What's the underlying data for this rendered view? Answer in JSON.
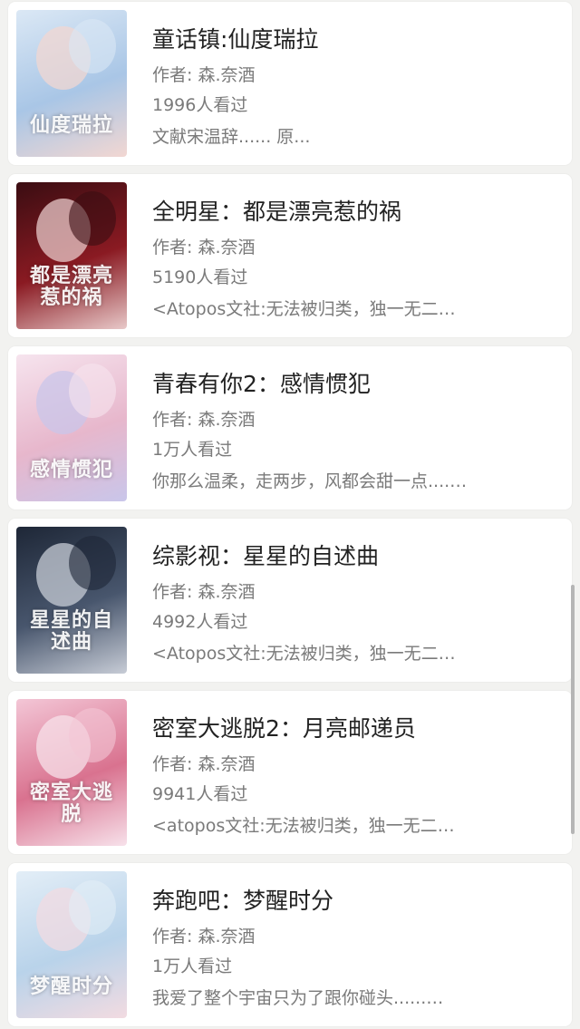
{
  "author_prefix": "作者:",
  "books": [
    {
      "title": "童话镇:仙度瑞拉",
      "author": "森.奈酒",
      "views": "1996人看过",
      "desc": "文献宋温辞...... 原...",
      "cover_text": "仙度瑞拉",
      "cover_colors": [
        "#dbe8f5",
        "#a9c6e6",
        "#f2d7d2"
      ]
    },
    {
      "title": "全明星：都是漂亮惹的祸",
      "author": "森.奈酒",
      "views": "5190人看过",
      "desc": "<Atopos文社:无法被归类，独一无二…",
      "cover_text": "都是漂亮惹的祸",
      "cover_colors": [
        "#3a0d12",
        "#8a1a22",
        "#e8c9c9"
      ]
    },
    {
      "title": "青春有你2：感情惯犯",
      "author": "森.奈酒",
      "views": "1万人看过",
      "desc": "你那么温柔，走两步，风都会甜一点....…",
      "cover_text": "感情惯犯",
      "cover_colors": [
        "#f6e4ee",
        "#e7b7cc",
        "#c9c6ea"
      ]
    },
    {
      "title": "综影视：星星的自述曲",
      "author": "森.奈酒",
      "views": "4992人看过",
      "desc": "<Atopos文社:无法被归类，独一无二…",
      "cover_text": "星星的自述曲",
      "cover_colors": [
        "#1e2737",
        "#48566d",
        "#c7ccd6"
      ]
    },
    {
      "title": "密室大逃脱2：月亮邮递员",
      "author": "森.奈酒",
      "views": "9941人看过",
      "desc": "<atopos文社:无法被归类，独一无二…",
      "cover_text": "密室大逃脱",
      "cover_colors": [
        "#f3c6d6",
        "#d9728f",
        "#f7e1ea"
      ]
    },
    {
      "title": "奔跑吧：梦醒时分",
      "author": "森.奈酒",
      "views": "1万人看过",
      "desc": "我爱了整个宇宙只为了跟你碰头......…",
      "cover_text": "梦醒时分",
      "cover_colors": [
        "#e3eef7",
        "#b9d3ea",
        "#f2dbe1"
      ]
    }
  ]
}
